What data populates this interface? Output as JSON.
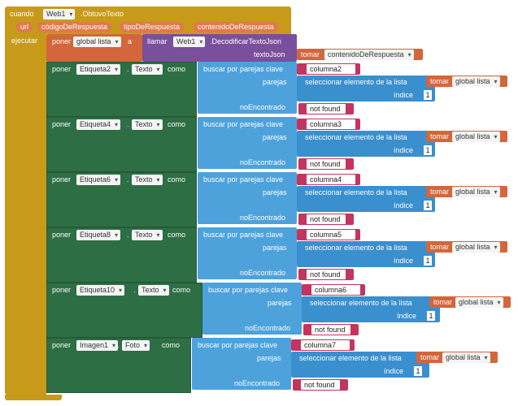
{
  "event": {
    "when": "cuando",
    "component": "Web1",
    "event_name": ".ObtuvoTexto",
    "params": [
      "url",
      "códigoDeRespuesta",
      "tipoDeRespuesta",
      "contenidoDeRespuesta"
    ],
    "do": "ejecutar"
  },
  "set_global": {
    "set": "poner",
    "var": "global lista",
    "to": "a",
    "call": "llamar",
    "component": "Web1",
    "method": ".DecodificarTextoJson",
    "arg_label": "textoJson",
    "get": "tomar",
    "arg_var": "contenidoDeRespuesta"
  },
  "labels": {
    "set": "poner",
    "dot": ".",
    "to": "como",
    "lookup": "buscar por parejas  clave",
    "pairs": "parejas",
    "select": "seleccionar elemento de la lista",
    "get": "tomar",
    "list_var": "global lista",
    "index": "índice",
    "not_found_label": "noEncontrado",
    "not_found_value": "not found"
  },
  "rows": [
    {
      "component": "Etiqueta2",
      "prop": "Texto",
      "key": "columna2",
      "index": "1"
    },
    {
      "component": "Etiqueta4",
      "prop": "Texto",
      "key": "columna3",
      "index": "1"
    },
    {
      "component": "Etiqueta6",
      "prop": "Texto",
      "key": "columna4",
      "index": "1"
    },
    {
      "component": "Etiqueta8",
      "prop": "Texto",
      "key": "columna5",
      "index": "1"
    },
    {
      "component": "Etiqueta10",
      "prop": "Texto",
      "key": "columna6",
      "index": "1"
    },
    {
      "component": "Imagen1",
      "prop": "Foto",
      "key": "columna7",
      "index": "1"
    }
  ]
}
